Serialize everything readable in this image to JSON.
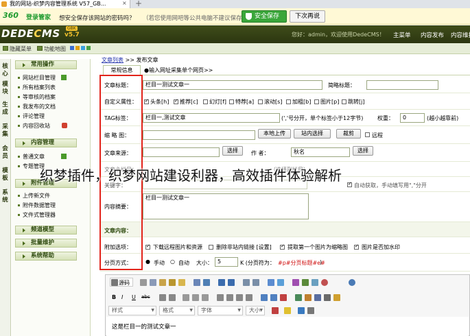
{
  "browser": {
    "tab_title": "我的网站-织梦内容管理系统 V57_GB...",
    "close": "×",
    "new_tab": "+"
  },
  "password_bar": {
    "logo": "360",
    "logo_sub": "登录管家",
    "question": "想安全保存该网站的密码吗？",
    "note": "（若您使用网吧等公共电脑不建议保存）",
    "save_button": "安全保存",
    "next_button": "下次再说"
  },
  "header": {
    "brand_a": "DEDE",
    "brand_b": "C",
    "brand_c": "MS",
    "version": "v5.7",
    "version_tag": "GBK",
    "welcome": "您好：admin，欢迎使用DedeCMS！",
    "nav": [
      "主菜单",
      "内容发布",
      "内容维护"
    ]
  },
  "subbar": {
    "items": [
      "隐藏菜单",
      "功能地图"
    ],
    "colors": [
      "#3a6dd1",
      "#e0a010",
      "#3aa0e0",
      "#46a046"
    ]
  },
  "vtabs": [
    "核心",
    "模块",
    "生成",
    "采集",
    "会员",
    "模板",
    "系统"
  ],
  "sidebar": {
    "groups": [
      {
        "title": "常用操作",
        "items": [
          "网站栏目管理",
          "所有档案列表",
          "等审核的档案",
          "我发布的文档",
          "评论管理",
          "内容回收站"
        ]
      },
      {
        "title": "内容管理",
        "items": [
          "普通文章",
          "专题管理"
        ]
      },
      {
        "title": "附件管理",
        "items": [
          "上传新文件",
          "附件数据管理",
          "文件式管理器"
        ]
      },
      {
        "title": "频道模型",
        "items": []
      },
      {
        "title": "批量维护",
        "items": []
      },
      {
        "title": "系统帮助",
        "items": []
      }
    ]
  },
  "breadcrumb": {
    "link": "文章列表",
    "sep": ">>",
    "current": "发布文章"
  },
  "tabs": {
    "tab1": "常规信息",
    "tab2": "●输入网址采集单个网页>>"
  },
  "form": {
    "title_label": "文章标题：",
    "title_value": "栏目一测试文章一",
    "short_title_label": "简略标题：",
    "attr_label": "自定义属性：",
    "attrs": [
      {
        "label": "头条[h]",
        "checked": true
      },
      {
        "label": "推荐[c]",
        "checked": true
      },
      {
        "label": "幻灯[f]",
        "checked": false
      },
      {
        "label": "特荐[a]",
        "checked": false
      },
      {
        "label": "滚动[s]",
        "checked": false
      },
      {
        "label": "加粗[b]",
        "checked": false
      },
      {
        "label": "图片[p]",
        "checked": false
      },
      {
        "label": "跳转[j]",
        "checked": false
      }
    ],
    "tag_label": "TAG标签：",
    "tag_value": "栏目一,测试文章",
    "tag_hint": "(','号分开，单个标签小于12字节)",
    "weight_label": "权重：",
    "weight_value": "0",
    "weight_hint": "(越小越靠前)",
    "thumb_label": "缩 略 图：",
    "upload_btn": "本地上传",
    "site_select_btn": "站内选择",
    "crop_btn": "裁剪",
    "remote_label": "远程",
    "source_label": "文章来源：",
    "select_btn": "选择",
    "author_label": "作  者：",
    "author_value": "秋名",
    "select_btn2": "选择",
    "column_label": "文章主栏目：",
    "column_hint": "（选择副栏目）",
    "keywords_label": "关键字：",
    "auto_kw": "自动获取，手动填写用\",\"分开",
    "summary_label": "内容摘要：",
    "summary_value": "栏目一测试文章一",
    "content_label": "文章内容：",
    "extra_label": "附加选项：",
    "extras": [
      {
        "label": "下载远程图片和资源",
        "checked": true
      },
      {
        "label": "删除非站内链接 [设置]",
        "checked": false
      },
      {
        "label": "提取第一个图片为缩略图",
        "checked": true
      },
      {
        "label": "图片是否加水印",
        "checked": true
      }
    ],
    "paging_label": "分页方式：",
    "paging_manual": "手动",
    "paging_auto": "自动",
    "paging_size_label": "大小：",
    "paging_size": "5",
    "paging_unit": "K (分页符为：",
    "paging_mark": "#p#分页标题#e#",
    "paging_end": ")"
  },
  "editor": {
    "source_btn": "源码",
    "fmt": [
      "B",
      "I",
      "U",
      "abc"
    ],
    "dropdowns": [
      "样式",
      "格式",
      "字体",
      "大小"
    ],
    "content": "这是栏目一的测试文章一"
  },
  "overlay": "织梦插件，织梦网站建设利器，高效插件体验解析"
}
